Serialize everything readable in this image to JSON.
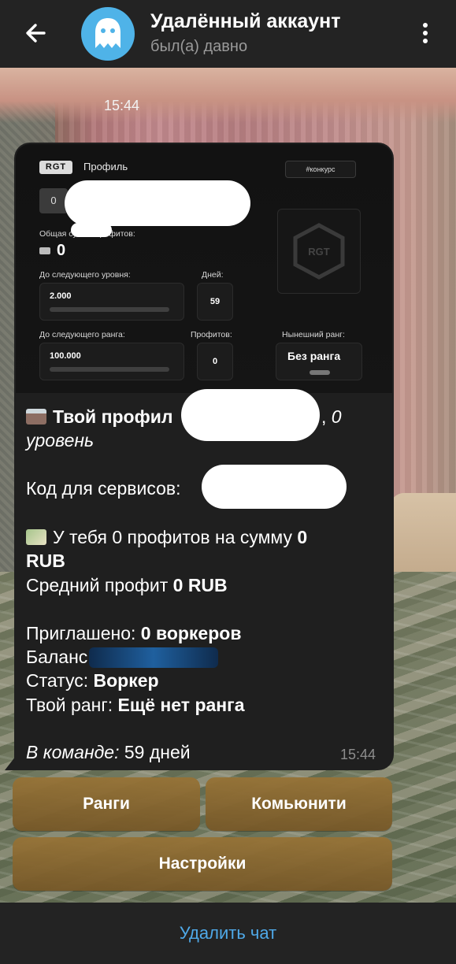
{
  "header": {
    "title": "Удалённый аккаунт",
    "status": "был(а) давно"
  },
  "chat": {
    "date_stamp": "15:44"
  },
  "card": {
    "badge": "RGT",
    "title": "Профиль",
    "tag": "#конкурс",
    "user_initial": "0",
    "total_label": "Общая сумма профитов:",
    "total_value": "0",
    "next_level_label": "До следующего уровня:",
    "next_level_value": "2.000",
    "days_label": "Дней:",
    "days_value": "59",
    "next_rank_label": "До следующего ранга:",
    "next_rank_value": "100.000",
    "profits_label": "Профитов:",
    "profits_value": "0",
    "current_rank_label": "Нынешний ранг:",
    "current_rank_value": "Без ранга",
    "logo_text": "RGT"
  },
  "message": {
    "line1_prefix": "Твой профил",
    "line1_suffix": "0",
    "line2": "уровень",
    "services_label": "Код для сервисов:",
    "profits_text_start": "У тебя 0 профитов на сумму ",
    "profits_sum": "0",
    "profits_currency": "RUB",
    "avg_label": "Средний профит ",
    "avg_value": "0 RUB",
    "invited_label": "Приглашено: ",
    "invited_value": "0 воркеров",
    "balance_label": "Баланс",
    "status_label": "Статус: ",
    "status_value": "Воркер",
    "rank_label": "Твой ранг: ",
    "rank_value": "Ещё нет ранга",
    "team_label": "В команде:",
    "team_value": " 59 дней",
    "time": "15:44"
  },
  "keyboard": {
    "ranks": "Ранги",
    "community": "Комьюнити",
    "settings": "Настройки"
  },
  "footer": {
    "delete_chat": "Удалить чат"
  },
  "colors": {
    "header_bg": "#232323",
    "bubble_bg": "#1f1f1f",
    "avatar_bg": "#4fb3e8",
    "link": "#4fa9e8",
    "button_gold": "#94723a"
  }
}
